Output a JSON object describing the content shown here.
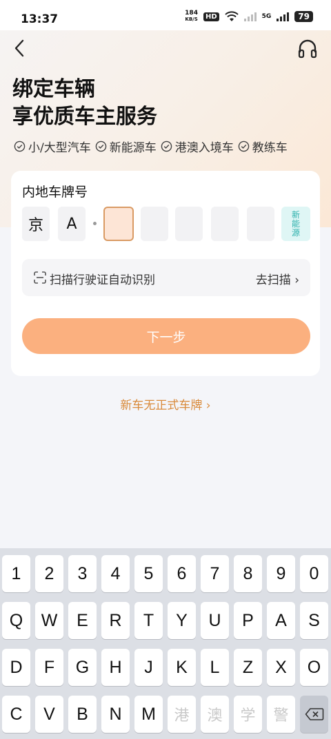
{
  "status": {
    "time": "13:37",
    "speed_value": "184",
    "speed_unit": "KB/S",
    "hd": "HD",
    "network": "5G",
    "battery": "79"
  },
  "header": {
    "title_line1": "绑定车辆",
    "title_line2": "享优质车主服务"
  },
  "tags": [
    "小/大型汽车",
    "新能源车",
    "港澳入境车",
    "教练车"
  ],
  "card": {
    "label": "内地车牌号",
    "plate": {
      "province": "京",
      "letter": "A",
      "ev_label": "新能源"
    },
    "scan_label": "扫描行驶证自动识别",
    "scan_action": "去扫描",
    "next": "下一步"
  },
  "new_car_link": "新车无正式车牌",
  "keyboard": {
    "row1": [
      "1",
      "2",
      "3",
      "4",
      "5",
      "6",
      "7",
      "8",
      "9",
      "0"
    ],
    "row2": [
      "Q",
      "W",
      "E",
      "R",
      "T",
      "Y",
      "U",
      "P",
      "A",
      "S"
    ],
    "row3": [
      "D",
      "F",
      "G",
      "H",
      "J",
      "K",
      "L",
      "Z",
      "X",
      "O"
    ],
    "row4": [
      "C",
      "V",
      "B",
      "N",
      "M",
      "港",
      "澳",
      "学",
      "警"
    ]
  },
  "colors": {
    "accent": "#fbb07f",
    "link": "#d98a3a",
    "ev": "#2fb1ad"
  }
}
